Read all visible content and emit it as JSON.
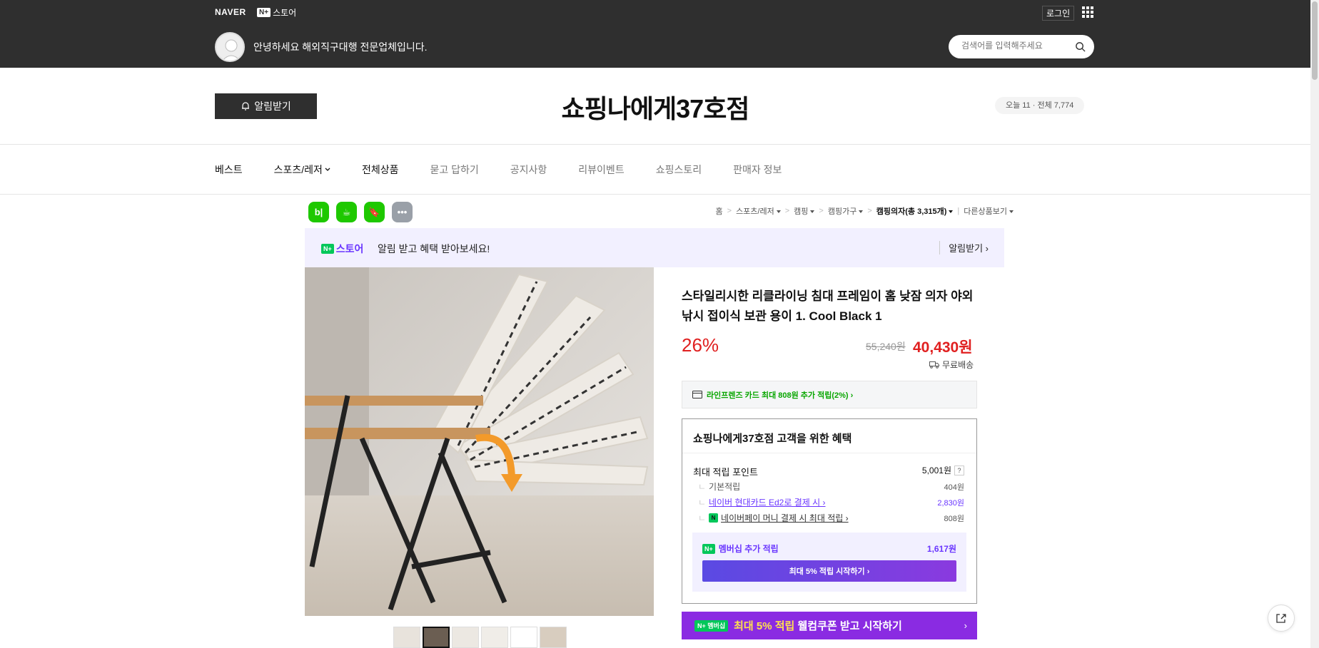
{
  "topbar": {
    "naver_logo": "NAVER",
    "np_badge": "N+",
    "np_store": "스토어",
    "login": "로그인",
    "greeting": "안녕하세요 해외직구대행 전문업체입니다.",
    "search_placeholder": "검색어를 입력해주세요"
  },
  "store_header": {
    "alarm_button": "알림받기",
    "store_name": "쇼핑나에게37호점",
    "visit_count": "오늘 11 · 전체 7,774"
  },
  "nav": {
    "items": [
      "베스트",
      "스포츠/레저",
      "전체상품",
      "묻고 답하기",
      "공지사항",
      "리뷰이벤트",
      "쇼핑스토리",
      "판매자 정보"
    ]
  },
  "share": {
    "blog": "b|",
    "cafe": "☕",
    "bookmark": "🔖",
    "more": "•••"
  },
  "breadcrumb": {
    "items": [
      "홈",
      "스포츠/레저",
      "캠핑",
      "캠핑가구",
      "캠핑의자(총 3,315개)",
      "다른상품보기"
    ]
  },
  "promo": {
    "np": "N+",
    "store": "스토어",
    "text": "알림 받고 혜택 받아보세요!",
    "link": "알림받기 ›"
  },
  "product": {
    "title": "스타일리시한 리클라이닝 침대 프레임이 홈 낮잠 의자 야외 낚시 접이식 보관 용이 1. Cool Black 1",
    "discount": "26%",
    "original_price": "55,240원",
    "sale_price": "40,430원",
    "shipping": "무료배송",
    "card_offer": "라인프렌즈 카드 최대 808원 추가 적립(2%) ›"
  },
  "benefit": {
    "title": "쇼핑나에게37호점 고객을 위한 혜택",
    "max_point_label": "최대 적립 포인트",
    "max_point_value": "5,001원",
    "qmark": "?",
    "basic_label": "기본적립",
    "basic_value": "404원",
    "card_label": "네이버 현대카드 Ed2로 결제 시 ›",
    "card_value": "2,830원",
    "pay_label": "네이버페이 머니 결제 시 최대 적립 ›",
    "pay_badge": "N",
    "pay_value": "808원",
    "member_np": "N+",
    "member_label": "멤버십 추가 적립",
    "member_value": "1,617원",
    "member_button": "최대 5% 적립 시작하기 ›"
  },
  "bottom_banner": {
    "badge": "N+ 멤버십",
    "highlight": "최대 5% 적립",
    "text": " 웰컴쿠폰 받고 시작하기",
    "chevron": "›"
  },
  "colors": {
    "topbar": "#2f2f2f",
    "naver_green": "#03c75a",
    "purple": "#6a36ff",
    "price_red": "#e02020"
  }
}
